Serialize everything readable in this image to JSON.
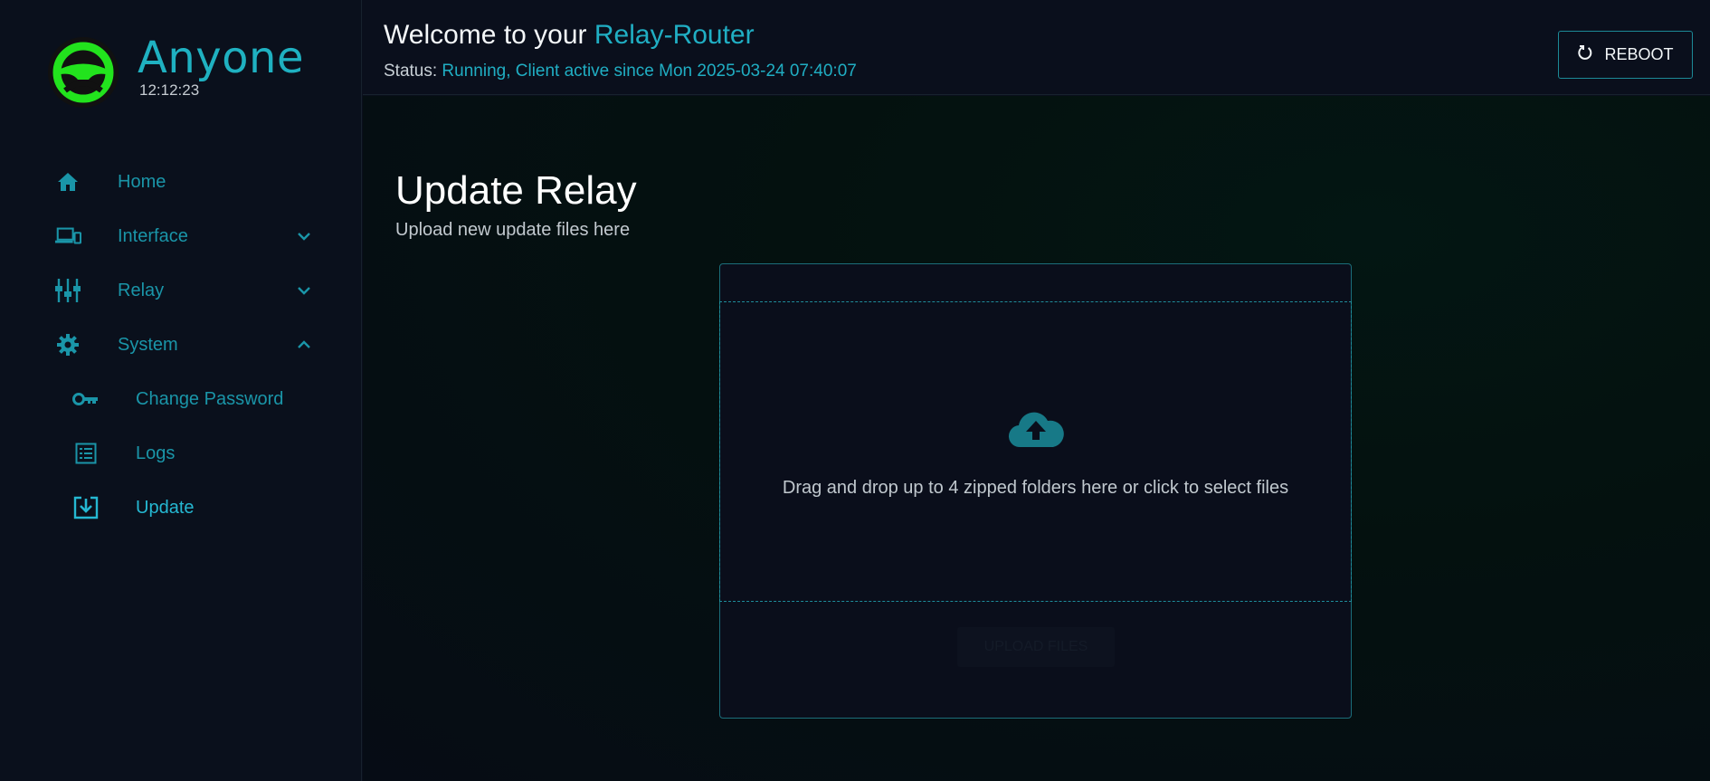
{
  "app": {
    "brand_name": "Anyone",
    "clock": "12:12:23",
    "accent_color": "#20aec3",
    "logo_color": "#22e31d"
  },
  "sidebar": {
    "items": [
      {
        "label": "Home",
        "icon": "home-icon"
      },
      {
        "label": "Interface",
        "icon": "devices-icon",
        "expanded": false
      },
      {
        "label": "Relay",
        "icon": "tune-icon",
        "expanded": false
      },
      {
        "label": "System",
        "icon": "gear-icon",
        "expanded": true
      },
      {
        "label": "Change Password",
        "icon": "key-icon",
        "sub": true
      },
      {
        "label": "Logs",
        "icon": "list-icon",
        "sub": true
      },
      {
        "label": "Update",
        "icon": "download-icon",
        "sub": true,
        "active": true
      }
    ]
  },
  "header": {
    "welcome_prefix": "Welcome to your ",
    "welcome_accent": "Relay-Router",
    "status_label": "Status: ",
    "status_value": "Running, Client active since Mon 2025-03-24 07:40:07",
    "reboot_label": "REBOOT"
  },
  "main": {
    "title": "Update Relay",
    "subtitle": "Upload new update files here",
    "dropzone_text": "Drag and drop up to 4 zipped folders here or click to select files",
    "upload_button_label": "UPLOAD FILES"
  }
}
